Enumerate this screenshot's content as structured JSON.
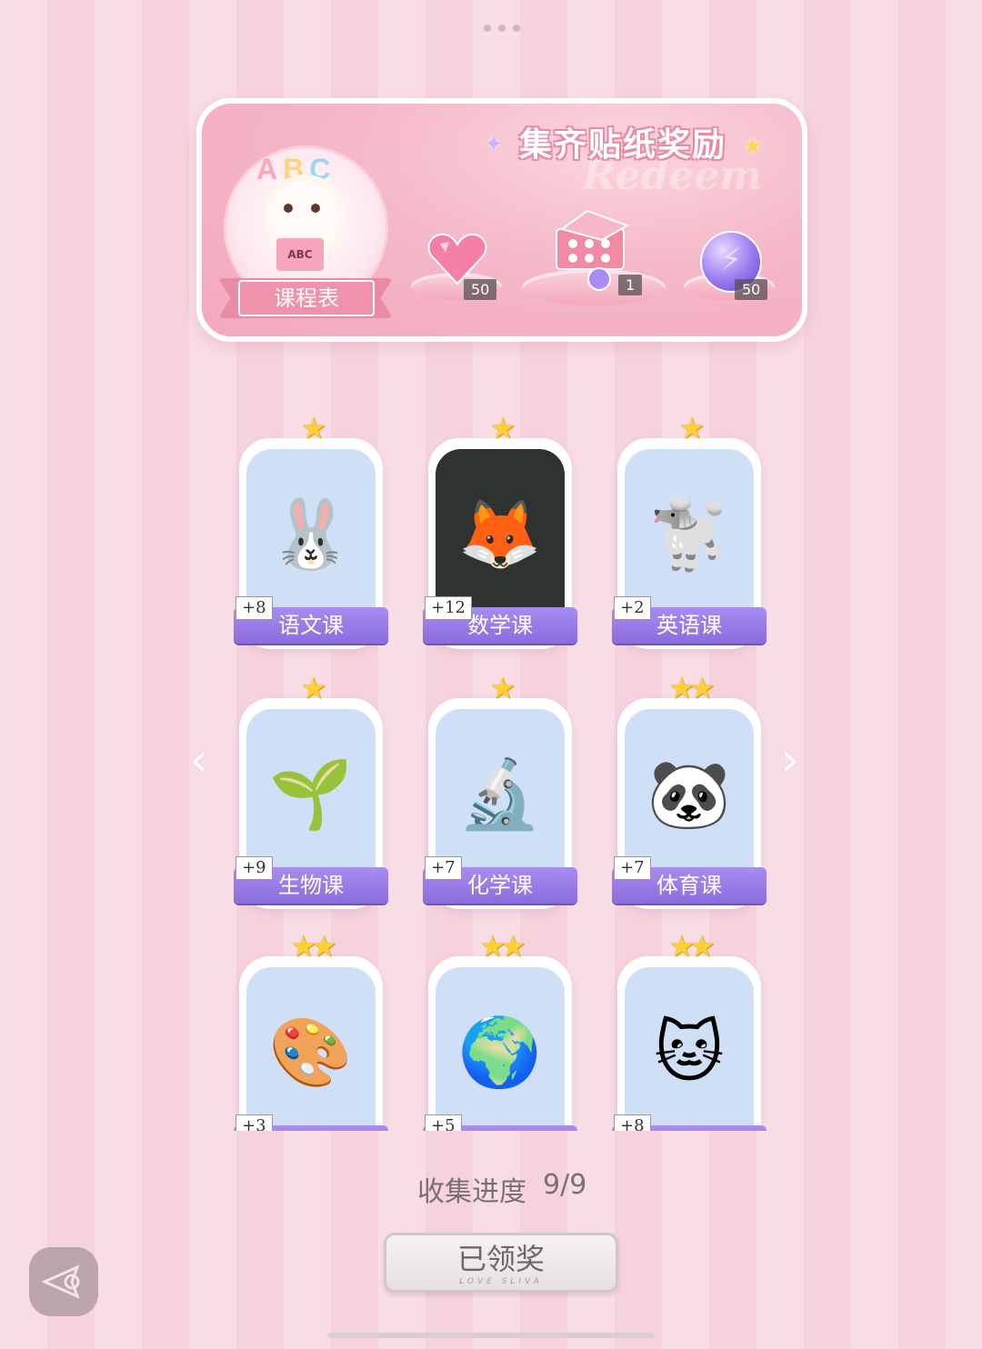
{
  "banner": {
    "title": "集齐贴纸奖励",
    "watermark": "Redeem",
    "course_label": "课程表",
    "course_book_text": "ABC",
    "rewards": [
      {
        "name": "pink-heart-gem-icon",
        "count": "50"
      },
      {
        "name": "gift-box-icon",
        "count": "1"
      },
      {
        "name": "purple-orb-icon",
        "count": "50"
      }
    ]
  },
  "stickers": [
    {
      "label": "语文课",
      "bonus": "+8",
      "stars": 1,
      "icon": "bunny-calligraphy"
    },
    {
      "label": "数学课",
      "bonus": "+12",
      "stars": 1,
      "icon": "fox-teacher"
    },
    {
      "label": "英语课",
      "bonus": "+2",
      "stars": 1,
      "icon": "poodle-abc"
    },
    {
      "label": "生物课",
      "bonus": "+9",
      "stars": 1,
      "icon": "sun-sprout"
    },
    {
      "label": "化学课",
      "bonus": "+7",
      "stars": 1,
      "icon": "microscope"
    },
    {
      "label": "体育课",
      "bonus": "+7",
      "stars": 2,
      "icon": "panda-pingpong"
    },
    {
      "label": "",
      "bonus": "+3",
      "stars": 2,
      "icon": "cat-painter"
    },
    {
      "label": "",
      "bonus": "+5",
      "stars": 2,
      "icon": "globe"
    },
    {
      "label": "",
      "bonus": "+8",
      "stars": 2,
      "icon": "cat-keyboard"
    }
  ],
  "progress": {
    "label": "收集进度",
    "value": "9/9"
  },
  "claim_button": {
    "label": "已领奖",
    "sub": "LOVE SLIVA"
  },
  "colors": {
    "accent_purple": "#8b6cde",
    "banner_pink": "#f2a9bc",
    "star": "#ffcf3a"
  }
}
